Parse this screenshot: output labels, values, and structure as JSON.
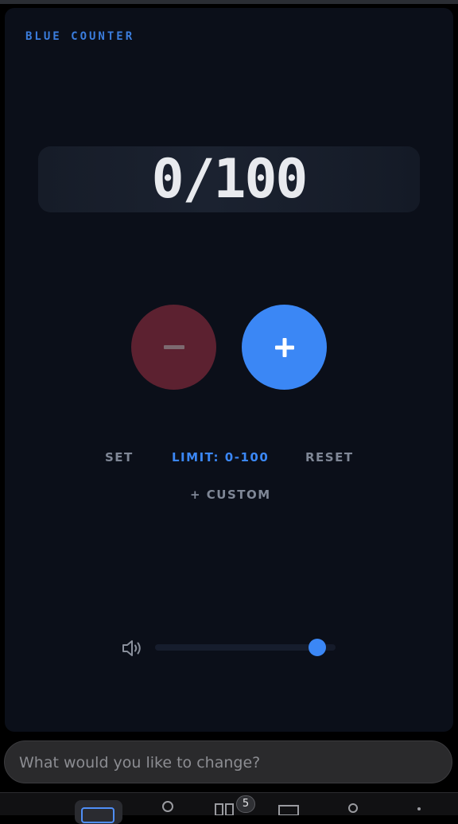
{
  "app": {
    "title": "BLUE COUNTER"
  },
  "counter": {
    "display": "0/100",
    "value": 0,
    "max": 100
  },
  "buttons": {
    "decrement_label": "−",
    "increment_label": "+",
    "set_label": "SET",
    "limit_label": "LIMIT: 0-100",
    "reset_label": "RESET",
    "custom_label": "+ CUSTOM"
  },
  "volume": {
    "icon": "speaker-icon",
    "level": 0.9
  },
  "prompt": {
    "placeholder": "What would you like to change?"
  },
  "bottom_nav": {
    "badge_count": "5"
  },
  "colors": {
    "accent": "#3b87f5",
    "title": "#3b7ddd",
    "decrement_bg": "#5c2130",
    "panel_bg": "#0b0f19"
  }
}
